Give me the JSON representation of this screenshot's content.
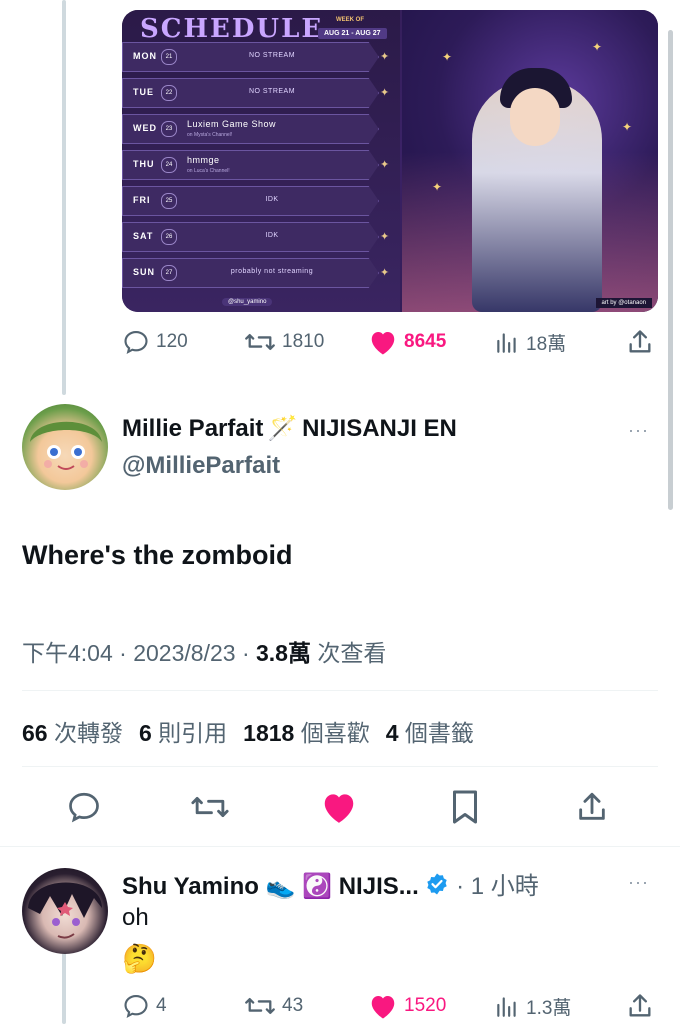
{
  "prev_tweet": {
    "image": {
      "title": "SCHEDULE",
      "week_label": "WEEK OF",
      "week_range": "AUG 21 - AUG 27",
      "days": [
        {
          "day": "MON",
          "num": "21",
          "event": "NO STREAM",
          "sub": ""
        },
        {
          "day": "TUE",
          "num": "22",
          "event": "NO STREAM",
          "sub": ""
        },
        {
          "day": "WED",
          "num": "23",
          "event": "Luxiem Game Show",
          "sub": "on Mysta's Channel!"
        },
        {
          "day": "THU",
          "num": "24",
          "event": "hmmge",
          "sub": "on Luca's Channel!"
        },
        {
          "day": "FRI",
          "num": "25",
          "event": "IDK",
          "sub": ""
        },
        {
          "day": "SAT",
          "num": "26",
          "event": "IDK",
          "sub": ""
        },
        {
          "day": "SUN",
          "num": "27",
          "event": "probably not streaming",
          "sub": ""
        }
      ],
      "handle": "@shu_yamino",
      "art_credit": "art by @otanaon"
    },
    "actions": {
      "replies": "120",
      "retweets": "1810",
      "likes": "8645",
      "views": "18萬"
    }
  },
  "main_tweet": {
    "display_name": "Millie Parfait",
    "name_emoji": "🪄",
    "name_suffix": "NIJISANJI EN",
    "handle": "@MillieParfait",
    "more": "···",
    "text": "Where's the zomboid",
    "time": "下午4:04",
    "date": "2023/8/23",
    "views": "3.8萬",
    "views_label": "次查看",
    "sep": "·",
    "stats": {
      "retweets": "66",
      "retweets_label": "次轉發",
      "quotes": "6",
      "quotes_label": "則引用",
      "likes": "1818",
      "likes_label": "個喜歡",
      "bookmarks": "4",
      "bookmarks_label": "個書籤"
    }
  },
  "reply": {
    "display_name": "Shu Yamino",
    "name_emoji_1": "👟",
    "name_emoji_2": "☯️",
    "name_suffix": "NIJIS...",
    "time": "1 小時",
    "sep": "·",
    "more": "···",
    "text": "oh",
    "emoji": "🤔",
    "actions": {
      "replies": "4",
      "retweets": "43",
      "likes": "1520",
      "views": "1.3萬"
    }
  },
  "colors": {
    "like": "#f91880",
    "muted": "#536471",
    "verified": "#1d9bf0"
  }
}
